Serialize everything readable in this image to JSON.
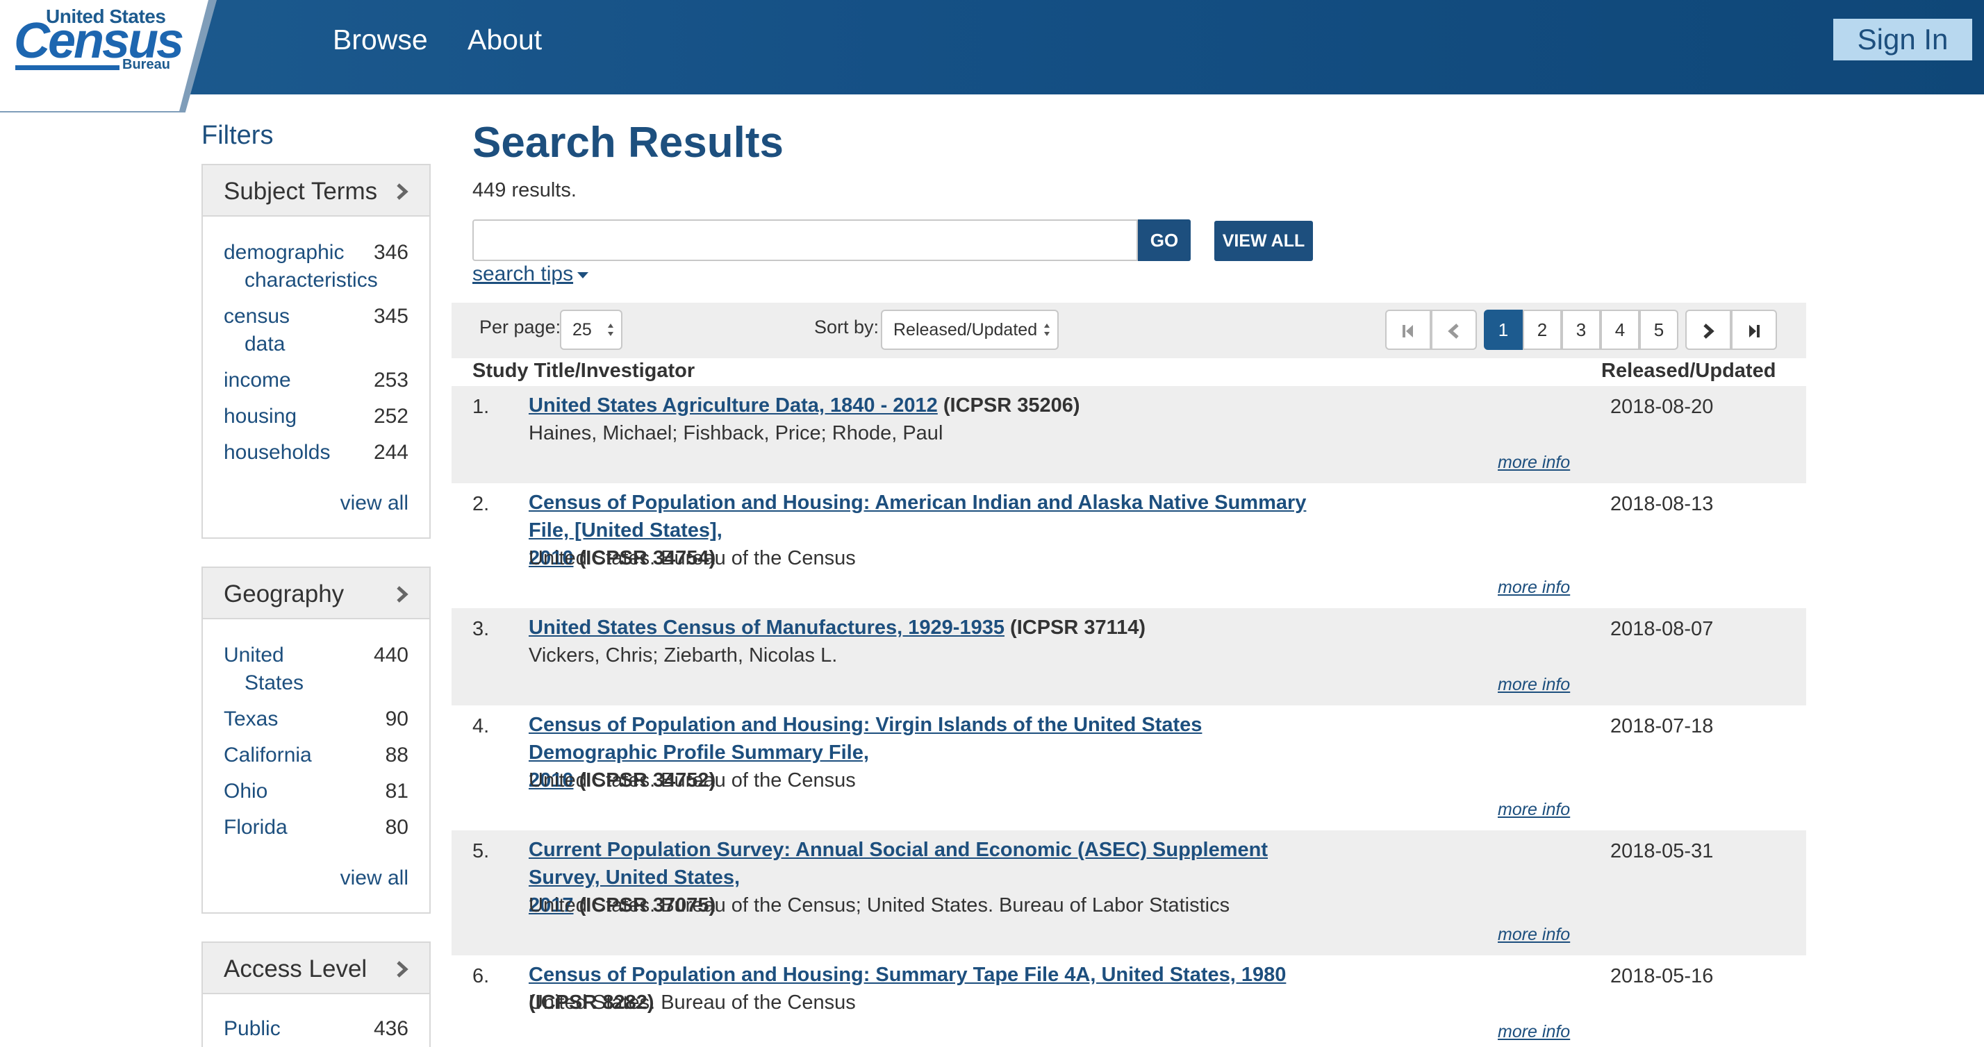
{
  "header": {
    "logo": {
      "top": "United States",
      "main": "Census",
      "sub": "Bureau"
    },
    "nav": [
      "Browse",
      "About"
    ],
    "signin_label": "Sign In"
  },
  "sidebar": {
    "title": "Filters",
    "panels": [
      {
        "title": "Subject Terms",
        "items": [
          {
            "label_1": "demographic",
            "label_2": "characteristics",
            "count": "346"
          },
          {
            "label_1": "census",
            "label_2": "data",
            "count": "345"
          },
          {
            "label_1": "income",
            "count": "253"
          },
          {
            "label_1": "housing",
            "count": "252"
          },
          {
            "label_1": "households",
            "count": "244"
          }
        ],
        "view_all": "view all"
      },
      {
        "title": "Geography",
        "items": [
          {
            "label_1": "United",
            "label_2": "States",
            "count": "440"
          },
          {
            "label_1": "Texas",
            "count": "90"
          },
          {
            "label_1": "California",
            "count": "88"
          },
          {
            "label_1": "Ohio",
            "count": "81"
          },
          {
            "label_1": "Florida",
            "count": "80"
          }
        ],
        "view_all": "view all"
      },
      {
        "title": "Access Level",
        "items": [
          {
            "label_1": "Public",
            "count": "436"
          }
        ]
      }
    ]
  },
  "main": {
    "title": "Search Results",
    "results_count": "449 results.",
    "search": {
      "value": "",
      "go_label": "GO",
      "view_all_label": "VIEW ALL",
      "tips_label": "search tips"
    },
    "toolbar": {
      "per_page_label": "Per page:",
      "per_page_value": "25",
      "sort_label": "Sort by:",
      "sort_value": "Released/Updated",
      "pages": [
        "1",
        "2",
        "3",
        "4",
        "5"
      ],
      "current_page": "1"
    },
    "columns": {
      "title": "Study Title/Investigator",
      "date": "Released/Updated"
    },
    "results": [
      {
        "num": "1.",
        "title_1": "United States Agriculture Data, 1840 - 2012",
        "id": "(ICPSR 35206)",
        "author": "Haines, Michael; Fishback, Price; Rhode, Paul",
        "date": "2018-08-20",
        "more": "more info"
      },
      {
        "num": "2.",
        "title_1": "Census of Population and Housing: American Indian and Alaska Native Summary File, [United States],",
        "title_2": "2010",
        "id": "(ICPSR 34754)",
        "author": "United States. Bureau of the Census",
        "date": "2018-08-13",
        "more": "more info"
      },
      {
        "num": "3.",
        "title_1": "United States Census of Manufactures, 1929-1935",
        "id": "(ICPSR 37114)",
        "author": "Vickers, Chris; Ziebarth, Nicolas L.",
        "date": "2018-08-07",
        "more": "more info"
      },
      {
        "num": "4.",
        "title_1": "Census of Population and Housing: Virgin Islands of the United States Demographic Profile Summary File,",
        "title_2": "2010",
        "id": "(ICPSR 34752)",
        "author": "United States. Bureau of the Census",
        "date": "2018-07-18",
        "more": "more info"
      },
      {
        "num": "5.",
        "title_1": "Current Population Survey: Annual Social and Economic (ASEC) Supplement Survey, United States,",
        "title_2": "2017",
        "id": "(ICPSR 37075)",
        "author": "United States. Bureau of the Census; United States. Bureau of Labor Statistics",
        "date": "2018-05-31",
        "more": "more info"
      },
      {
        "num": "6.",
        "title_1": "Census of Population and Housing: Summary Tape File 4A, United States, 1980",
        "id": "(ICPSR 8282)",
        "author": "United States. Bureau of the Census",
        "date": "2018-05-16",
        "more": "more info"
      }
    ]
  }
}
